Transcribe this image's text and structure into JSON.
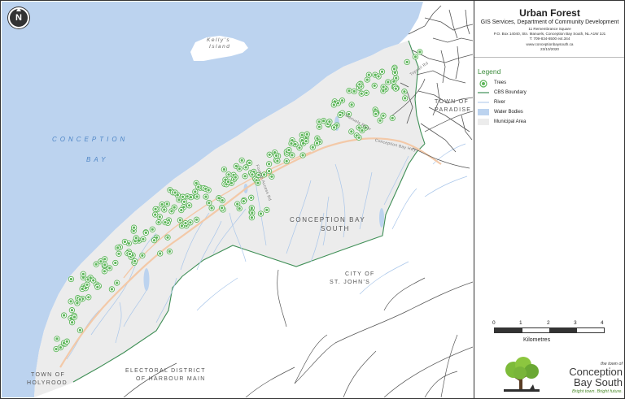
{
  "map": {
    "water_label_1": "CONCEPTION",
    "water_label_2": "BAY",
    "island_label_1": "Kelly's",
    "island_label_2": "Island",
    "municipality_label_1": "CONCEPTION BAY",
    "municipality_label_2": "SOUTH",
    "city_label_1": "CITY OF",
    "city_label_2": "ST. JOHN'S",
    "electoral_label_1": "ELECTORAL DISTRICT",
    "electoral_label_2": "OF HARBOUR MAIN",
    "town_holyrood_1": "TOWN OF",
    "town_holyrood_2": "HOLYROOD",
    "town_paradise_1": "TOWN OF",
    "town_paradise_2": "PARADISE",
    "road_1": "Conception Bay Hwy",
    "road_2": "Manuels River",
    "road_3": "Foxtrap Access Rd",
    "road_4": "Topsail Rd",
    "north_label": "N",
    "colors": {
      "water": "#bcd3ef",
      "municipal": "#ececec",
      "boundary": "#3f8f56",
      "tree": "#5db65a",
      "river": "#a9c6ea",
      "road": "#555555",
      "highway": "#f3c9a8"
    }
  },
  "panel": {
    "title": "Urban Forest",
    "subtitle": "GIS Services, Department of Community Development",
    "address_lines": [
      "11 Remembrance Square",
      "P.O. Box 14040, Stn. Manuels, Conception Bay South, NL A1W 3J1",
      "T: 709-834-6500 ext.344",
      "www.conceptionbaysouth.ca",
      "23/10/2020"
    ],
    "legend_title": "Legend",
    "legend": [
      {
        "label": "Trees",
        "icon": "tree-icon"
      },
      {
        "label": "CBS Boundary",
        "icon": "boundary-line-icon"
      },
      {
        "label": "River",
        "icon": "river-line-icon"
      },
      {
        "label": "Water Bodies",
        "icon": "water-swatch-icon"
      },
      {
        "label": "Municipal Area",
        "icon": "municipal-swatch-icon"
      }
    ],
    "scale_ticks": [
      "0",
      "1",
      "2",
      "3",
      "4"
    ],
    "scale_unit": "Kilometres",
    "logo_small": "the town of",
    "logo_line1": "Conception",
    "logo_line2": "Bay South",
    "logo_tagline": "Bright town. Bright future."
  }
}
